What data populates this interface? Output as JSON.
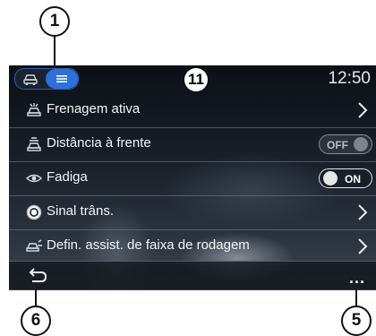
{
  "callouts": {
    "c1": "1",
    "c6": "6",
    "c5": "5"
  },
  "status": {
    "page_number": "11",
    "time": "12:50"
  },
  "rows": [
    {
      "label": "Frenagem ativa",
      "control": "chevron"
    },
    {
      "label": "Distância à frente",
      "control": "toggle",
      "toggle_label": "OFF"
    },
    {
      "label": "Fadiga",
      "control": "toggle",
      "toggle_label": "ON"
    },
    {
      "label": "Sinal trâns.",
      "control": "chevron"
    },
    {
      "label": "Defin. assist. de faixa de rodagem",
      "control": "chevron"
    }
  ],
  "bottom": {
    "more_label": "..."
  },
  "colors": {
    "accent": "#2f6fd8",
    "text": "#f4f4f4",
    "divider": "#8c96a5"
  }
}
